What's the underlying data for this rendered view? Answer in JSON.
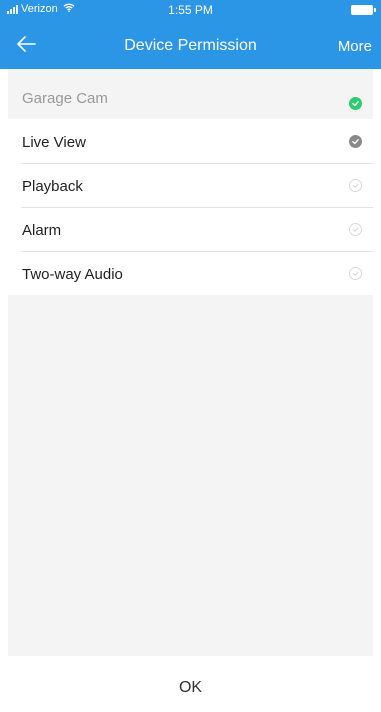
{
  "status_bar": {
    "carrier": "Verizon",
    "time": "1:55 PM",
    "icons": [
      "signal-icon",
      "wifi-icon",
      "battery-icon"
    ]
  },
  "nav": {
    "back_icon": "arrow-left-icon",
    "title": "Device Permission",
    "more_label": "More"
  },
  "device": {
    "name": "Garage Cam",
    "checked": true,
    "check_color": "#2ecc71"
  },
  "permissions": [
    {
      "label": "Live View",
      "checked": true
    },
    {
      "label": "Playback",
      "checked": false
    },
    {
      "label": "Alarm",
      "checked": false
    },
    {
      "label": "Two-way Audio",
      "checked": false
    }
  ],
  "footer": {
    "ok_label": "OK"
  },
  "colors": {
    "header_bg": "#2b95e6",
    "content_bg": "#f4f4f4",
    "checked_gray": "#8a8a8a",
    "checked_green": "#2ecc71"
  }
}
